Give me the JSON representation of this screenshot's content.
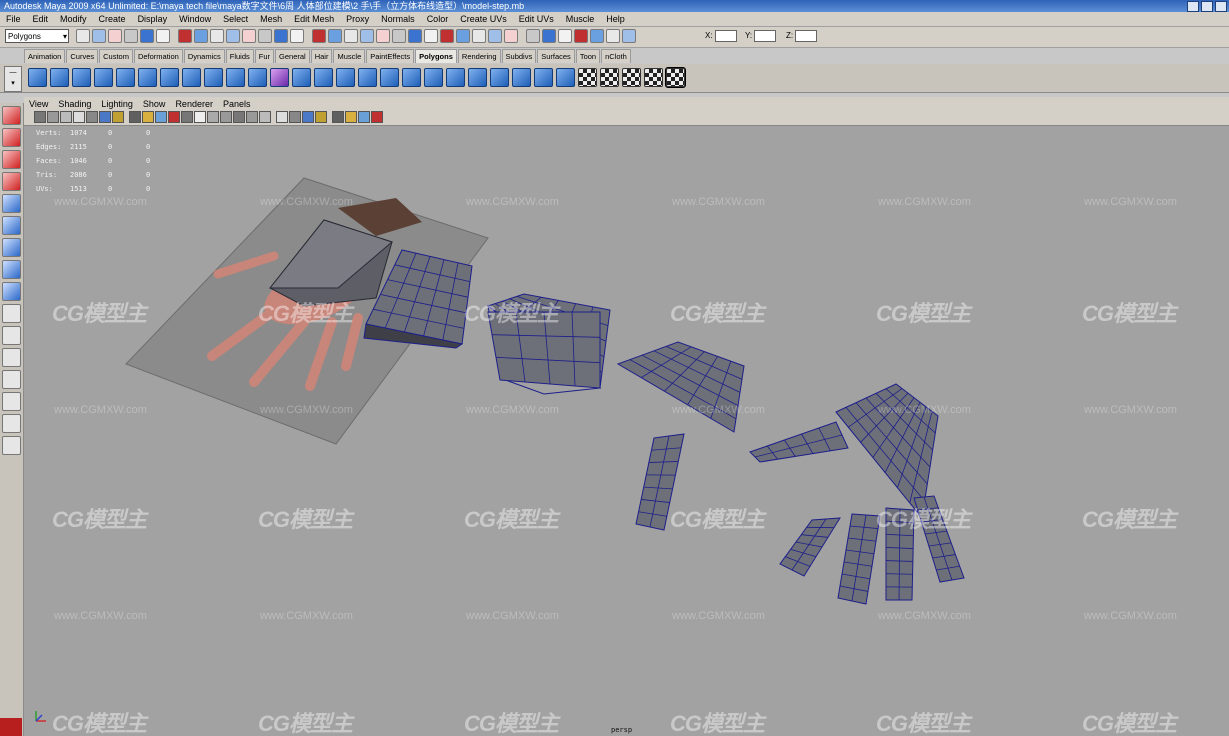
{
  "window": {
    "title": "Autodesk Maya 2009 x64 Unlimited: E:\\maya tech file\\maya数字文件\\6周 人体部位建模\\2 手\\手（立方体布线造型）\\model-step.mb"
  },
  "menubar": {
    "items": [
      "File",
      "Edit",
      "Modify",
      "Create",
      "Display",
      "Window",
      "Select",
      "Mesh",
      "Edit Mesh",
      "Proxy",
      "Normals",
      "Color",
      "Create UVs",
      "Edit UVs",
      "Muscle",
      "Help"
    ]
  },
  "statusline": {
    "mode": "Polygons",
    "x_label": "X:",
    "y_label": "Y:",
    "z_label": "Z:"
  },
  "shelf": {
    "tabs": [
      "Animation",
      "Curves",
      "Custom",
      "Deformation",
      "Dynamics",
      "Fluids",
      "Fur",
      "General",
      "Hair",
      "Muscle",
      "PaintEffects",
      "Polygons",
      "Rendering",
      "Subdivs",
      "Surfaces",
      "Toon",
      "nCloth"
    ],
    "active_tab": "Polygons",
    "icon_count": 30
  },
  "panel": {
    "menu": [
      "View",
      "Shading",
      "Lighting",
      "Show",
      "Renderer",
      "Panels"
    ],
    "camera": "persp"
  },
  "hud": {
    "rows": [
      {
        "label": "Verts:",
        "value": "1074",
        "c2": "0",
        "c3": "0"
      },
      {
        "label": "Edges:",
        "value": "2115",
        "c2": "0",
        "c3": "0"
      },
      {
        "label": "Faces:",
        "value": "1046",
        "c2": "0",
        "c3": "0"
      },
      {
        "label": "Tris:",
        "value": "2086",
        "c2": "0",
        "c3": "0"
      },
      {
        "label": "UVs:",
        "value": "1513",
        "c2": "0",
        "c3": "0"
      }
    ]
  },
  "watermark": {
    "logo": "CG模型主",
    "url": "www.CGMXW.com"
  },
  "colors": {
    "viewport_bg": "#a2a2a2",
    "mesh_face": "#6e7079",
    "wire": "#1d1f8a",
    "skin": "#c8857a"
  }
}
